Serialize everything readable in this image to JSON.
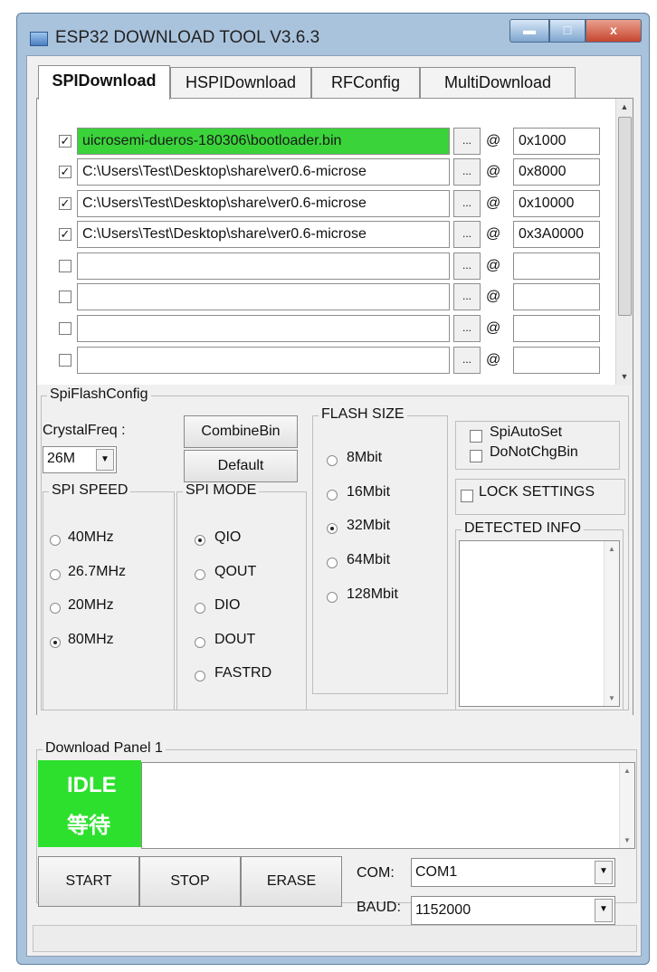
{
  "window": {
    "title": "ESP32 DOWNLOAD TOOL V3.6.3",
    "min_glyph": "▬",
    "max_glyph": "□",
    "close_glyph": "x"
  },
  "tabs": [
    "SPIDownload",
    "HSPIDownload",
    "RFConfig",
    "MultiDownload"
  ],
  "files": [
    {
      "checked": true,
      "path": "uicrosemi-dueros-180306\\bootloader.bin",
      "addr": "0x1000",
      "highlight": true
    },
    {
      "checked": true,
      "path": "C:\\Users\\Test\\Desktop\\share\\ver0.6-microse",
      "addr": "0x8000"
    },
    {
      "checked": true,
      "path": "C:\\Users\\Test\\Desktop\\share\\ver0.6-microse",
      "addr": "0x10000"
    },
    {
      "checked": true,
      "path": "C:\\Users\\Test\\Desktop\\share\\ver0.6-microse",
      "addr": "0x3A0000"
    },
    {
      "checked": false,
      "path": "",
      "addr": ""
    },
    {
      "checked": false,
      "path": "",
      "addr": ""
    },
    {
      "checked": false,
      "path": "",
      "addr": ""
    },
    {
      "checked": false,
      "path": "",
      "addr": ""
    }
  ],
  "browse_label": "...",
  "at_symbol": "@",
  "spiflash": {
    "group_title": "SpiFlashConfig",
    "crystal_label": "CrystalFreq :",
    "crystal_value": "26M",
    "combine_label": "CombineBin",
    "default_label": "Default",
    "spi_speed": {
      "title": "SPI SPEED",
      "options": [
        "40MHz",
        "26.7MHz",
        "20MHz",
        "80MHz"
      ],
      "selected": 3
    },
    "spi_mode": {
      "title": "SPI MODE",
      "options": [
        "QIO",
        "QOUT",
        "DIO",
        "DOUT",
        "FASTRD"
      ],
      "selected": 0
    },
    "flash_size": {
      "title": "FLASH SIZE",
      "options": [
        "8Mbit",
        "16Mbit",
        "32Mbit",
        "64Mbit",
        "128Mbit"
      ],
      "selected": 2
    },
    "spi_auto_set": "SpiAutoSet",
    "do_not_chg_bin": "DoNotChgBin",
    "lock_settings": "LOCK SETTINGS",
    "detected_info": "DETECTED INFO"
  },
  "download": {
    "panel_title": "Download Panel 1",
    "status_en": "IDLE",
    "status_zh": "等待",
    "start": "START",
    "stop": "STOP",
    "erase": "ERASE",
    "com_label": "COM:",
    "com_value": "COM1",
    "baud_label": "BAUD:",
    "baud_value": "1152000"
  },
  "colors": {
    "idle_green": "#2ee02e",
    "path_highlight": "#3ad33a"
  }
}
